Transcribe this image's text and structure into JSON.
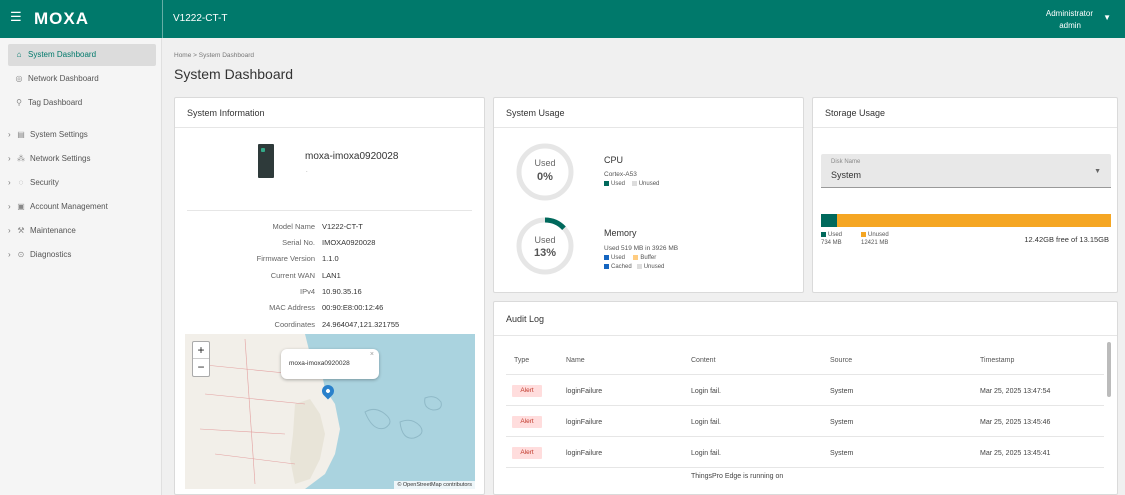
{
  "header": {
    "logo": "MOXA",
    "device": "V1222-CT-T",
    "user_role": "Administrator",
    "user_name": "admin",
    "accent": "#00796b"
  },
  "sidebar": {
    "items": [
      {
        "label": "System Dashboard",
        "icon": "home-icon",
        "expandable": false,
        "active": true
      },
      {
        "label": "Network Dashboard",
        "icon": "globe-icon",
        "expandable": false
      },
      {
        "label": "Tag Dashboard",
        "icon": "tag-icon",
        "expandable": false
      },
      {
        "label": "System Settings",
        "icon": "settings-icon",
        "expandable": true
      },
      {
        "label": "Network Settings",
        "icon": "network-icon",
        "expandable": true
      },
      {
        "label": "Security",
        "icon": "shield-icon",
        "expandable": true
      },
      {
        "label": "Account Management",
        "icon": "account-icon",
        "expandable": true
      },
      {
        "label": "Maintenance",
        "icon": "wrench-icon",
        "expandable": true
      },
      {
        "label": "Diagnostics",
        "icon": "diagnostics-icon",
        "expandable": true
      }
    ]
  },
  "breadcrumb": {
    "home": "Home",
    "separator": ">",
    "current": "System Dashboard"
  },
  "page_title": "System Dashboard",
  "system_info": {
    "title": "System Information",
    "device_name": "moxa-imoxa0920028",
    "device_sub": ".",
    "fields": [
      {
        "label": "Model Name",
        "value": "V1222-CT-T"
      },
      {
        "label": "Serial No.",
        "value": "IMOXA0920028"
      },
      {
        "label": "Firmware Version",
        "value": "1.1.0"
      },
      {
        "label": "Current WAN",
        "value": "LAN1"
      },
      {
        "label": "IPv4",
        "value": "10.90.35.16"
      },
      {
        "label": "MAC Address",
        "value": "00:90:E8:00:12:46"
      },
      {
        "label": "Coordinates",
        "value": "24.964047,121.321755"
      }
    ],
    "map": {
      "popup": "moxa-imoxa0920028",
      "close": "×",
      "zoom_in": "+",
      "zoom_out": "−",
      "attribution": "© OpenStreetMap contributors"
    }
  },
  "system_usage": {
    "title": "System Usage",
    "cpu": {
      "gauge_label": "Used",
      "percent": 0,
      "percent_text": "0%",
      "title": "CPU",
      "sub": "Cortex-A53",
      "legend": [
        {
          "label": "Used",
          "color": "#00695c"
        },
        {
          "label": "Unused",
          "color": "#dddddd"
        }
      ]
    },
    "memory": {
      "gauge_label": "Used",
      "percent": 13,
      "percent_text": "13%",
      "title": "Memory",
      "sub": "Used 519 MB in 3926 MB",
      "legend": [
        {
          "label": "Used",
          "color": "#1565c0"
        },
        {
          "label": "Buffer",
          "color": "#ffcc80"
        },
        {
          "label": "Cached",
          "color": "#1565c0"
        },
        {
          "label": "Unused",
          "color": "#dddddd"
        }
      ]
    }
  },
  "storage": {
    "title": "Storage Usage",
    "disk_label": "Disk Name",
    "disk_value": "System",
    "used_fraction": 0.056,
    "legend": [
      {
        "label": "Used",
        "value": "734 MB",
        "color": "#00695c"
      },
      {
        "label": "Unused",
        "value": "12421 MB",
        "color": "#f5a623"
      }
    ],
    "free_text": "12.42GB free of 13.15GB"
  },
  "audit_log": {
    "title": "Audit Log",
    "columns": [
      "Type",
      "Name",
      "Content",
      "Source",
      "Timestamp"
    ],
    "rows": [
      {
        "type": "Alert",
        "name": "loginFailure",
        "content": "Login fail.",
        "source": "System",
        "timestamp": "Mar 25, 2025 13:47:54"
      },
      {
        "type": "Alert",
        "name": "loginFailure",
        "content": "Login fail.",
        "source": "System",
        "timestamp": "Mar 25, 2025 13:45:46"
      },
      {
        "type": "Alert",
        "name": "loginFailure",
        "content": "Login fail.",
        "source": "System",
        "timestamp": "Mar 25, 2025 13:45:41"
      }
    ],
    "partial_row_content": "ThingsPro Edge is running on"
  }
}
